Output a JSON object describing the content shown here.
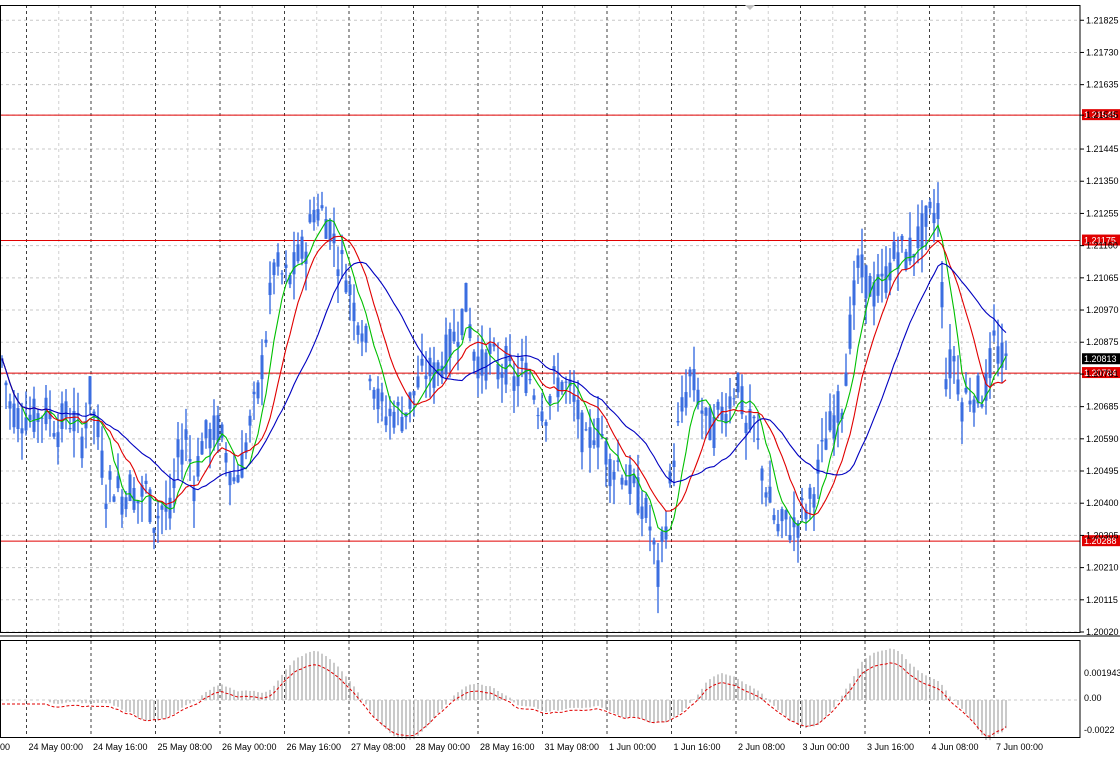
{
  "chart_data": {
    "type": "candlestick",
    "symbol_view": "price chart with moving averages and oscillator",
    "price_axis": {
      "ticks": [
        "1.21825",
        "1.21730",
        "1.21635",
        "1.21545",
        "1.21445",
        "1.21350",
        "1.21255",
        "1.21160",
        "1.21065",
        "1.20970",
        "1.20875",
        "1.20781",
        "1.20685",
        "1.20590",
        "1.20495",
        "1.20400",
        "1.20305",
        "1.20210",
        "1.20115",
        "1.20020"
      ],
      "ylim": [
        1.2002,
        1.2187
      ]
    },
    "time_axis": {
      "labels": [
        "00",
        "24 May 00:00",
        "24 May 16:00",
        "25 May 08:00",
        "26 May 00:00",
        "26 May 16:00",
        "27 May 08:00",
        "28 May 00:00",
        "28 May 16:00",
        "31 May 08:00",
        "1 Jun 00:00",
        "1 Jun 16:00",
        "2 Jun 08:00",
        "3 Jun 00:00",
        "3 Jun 16:00",
        "4 Jun 08:00",
        "7 Jun 00:00"
      ]
    },
    "horizontal_levels": [
      {
        "value": 1.21545,
        "label": "1.21545",
        "color": "#e00000"
      },
      {
        "value": 1.21175,
        "label": "1.21175",
        "color": "#e00000"
      },
      {
        "value": 1.20784,
        "label": "1.20784",
        "color": "#e00000"
      },
      {
        "value": 1.20288,
        "label": "1.20288",
        "color": "#e00000"
      }
    ],
    "current_price": {
      "value": 1.20813,
      "label": "1.20813",
      "color": "#000000"
    },
    "moving_averages": [
      {
        "color": "#00c000"
      },
      {
        "color": "#e00000"
      },
      {
        "color": "#0000c0"
      }
    ],
    "price_path_points": [
      [
        0,
        1.2082
      ],
      [
        8,
        1.2069
      ],
      [
        16,
        1.2066
      ],
      [
        24,
        1.2066
      ],
      [
        32,
        1.2065
      ],
      [
        40,
        1.2067
      ],
      [
        48,
        1.2066
      ],
      [
        56,
        1.2062
      ],
      [
        64,
        1.2066
      ],
      [
        72,
        1.2064
      ],
      [
        80,
        1.2059
      ],
      [
        88,
        1.2072
      ],
      [
        96,
        1.206
      ],
      [
        104,
        1.2044
      ],
      [
        112,
        1.2046
      ],
      [
        120,
        1.2042
      ],
      [
        128,
        1.2045
      ],
      [
        136,
        1.2041
      ],
      [
        144,
        1.2044
      ],
      [
        152,
        1.2035
      ],
      [
        160,
        1.2039
      ],
      [
        168,
        1.2036
      ],
      [
        176,
        1.2053
      ],
      [
        184,
        1.206
      ],
      [
        192,
        1.2046
      ],
      [
        200,
        1.2058
      ],
      [
        208,
        1.206
      ],
      [
        216,
        1.2062
      ],
      [
        224,
        1.2055
      ],
      [
        232,
        1.2047
      ],
      [
        240,
        1.2052
      ],
      [
        248,
        1.2063
      ],
      [
        256,
        1.2072
      ],
      [
        264,
        1.209
      ],
      [
        272,
        1.211
      ],
      [
        280,
        1.2107
      ],
      [
        288,
        1.2106
      ],
      [
        296,
        1.2112
      ],
      [
        304,
        1.2116
      ],
      [
        312,
        1.2127
      ],
      [
        320,
        1.2126
      ],
      [
        328,
        1.2122
      ],
      [
        336,
        1.2113
      ],
      [
        344,
        1.2108
      ],
      [
        352,
        1.2098
      ],
      [
        360,
        1.2093
      ],
      [
        368,
        1.2081
      ],
      [
        376,
        1.207
      ],
      [
        384,
        1.2066
      ],
      [
        392,
        1.2067
      ],
      [
        400,
        1.2066
      ],
      [
        408,
        1.207
      ],
      [
        416,
        1.2075
      ],
      [
        424,
        1.2079
      ],
      [
        432,
        1.2078
      ],
      [
        440,
        1.2082
      ],
      [
        448,
        1.2086
      ],
      [
        456,
        1.2092
      ],
      [
        464,
        1.2099
      ],
      [
        472,
        1.2085
      ],
      [
        480,
        1.208
      ],
      [
        488,
        1.2084
      ],
      [
        496,
        1.2079
      ],
      [
        504,
        1.2081
      ],
      [
        512,
        1.2075
      ],
      [
        520,
        1.2079
      ],
      [
        528,
        1.2077
      ],
      [
        536,
        1.207
      ],
      [
        544,
        1.2068
      ],
      [
        552,
        1.2075
      ],
      [
        560,
        1.2076
      ],
      [
        568,
        1.2072
      ],
      [
        576,
        1.2066
      ],
      [
        584,
        1.2056
      ],
      [
        592,
        1.2062
      ],
      [
        600,
        1.206
      ],
      [
        608,
        1.2051
      ],
      [
        616,
        1.2052
      ],
      [
        624,
        1.2048
      ],
      [
        632,
        1.2044
      ],
      [
        640,
        1.204
      ],
      [
        648,
        1.2033
      ],
      [
        656,
        1.2018
      ],
      [
        664,
        1.2035
      ],
      [
        672,
        1.2055
      ],
      [
        680,
        1.2067
      ],
      [
        688,
        1.2077
      ],
      [
        696,
        1.2072
      ],
      [
        704,
        1.2063
      ],
      [
        712,
        1.2062
      ],
      [
        720,
        1.2067
      ],
      [
        728,
        1.2071
      ],
      [
        736,
        1.2077
      ],
      [
        744,
        1.2061
      ],
      [
        752,
        1.2063
      ],
      [
        760,
        1.205
      ],
      [
        768,
        1.204
      ],
      [
        776,
        1.2032
      ],
      [
        784,
        1.2034
      ],
      [
        792,
        1.2033
      ],
      [
        800,
        1.2037
      ],
      [
        808,
        1.204
      ],
      [
        816,
        1.2049
      ],
      [
        824,
        1.2059
      ],
      [
        832,
        1.2065
      ],
      [
        840,
        1.207
      ],
      [
        848,
        1.2091
      ],
      [
        856,
        1.2109
      ],
      [
        864,
        1.2106
      ],
      [
        872,
        1.2102
      ],
      [
        880,
        1.2104
      ],
      [
        888,
        1.211
      ],
      [
        896,
        1.2115
      ],
      [
        904,
        1.2113
      ],
      [
        912,
        1.2116
      ],
      [
        920,
        1.212
      ],
      [
        928,
        1.2124
      ],
      [
        936,
        1.2127
      ],
      [
        944,
        1.2078
      ],
      [
        952,
        1.2083
      ],
      [
        960,
        1.207
      ],
      [
        968,
        1.2073
      ],
      [
        976,
        1.2072
      ],
      [
        984,
        1.2074
      ],
      [
        992,
        1.2087
      ],
      [
        1000,
        1.2082
      ],
      [
        1008,
        1.208
      ]
    ],
    "oscillator": {
      "ticks": [
        "0.001943",
        "0.00",
        "-0.0022"
      ],
      "zero_label": "0.00"
    }
  }
}
